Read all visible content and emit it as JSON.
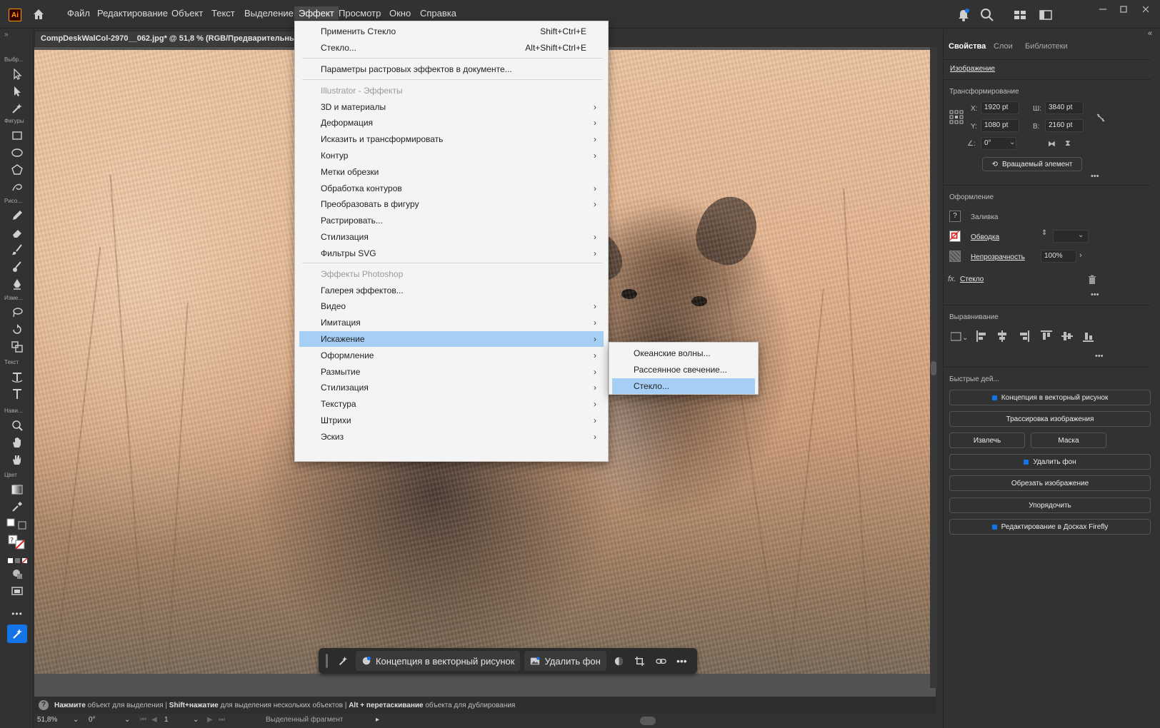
{
  "app": {
    "logo": "Ai",
    "menu": [
      "Файл",
      "Редактирование",
      "Объект",
      "Текст",
      "Выделение",
      "Эффект",
      "Просмотр",
      "Окно",
      "Справка"
    ],
    "active_menu": "Эффект"
  },
  "document": {
    "tab_title": "CompDeskWalCol-2970__062.jpg* @ 51,8 % (RGB/Предварительный"
  },
  "toolbar": {
    "section_labels": [
      "Выбр...",
      "Фигуры",
      "Рисо...",
      "Изме...",
      "Текст",
      "Нави...",
      "Цвет"
    ],
    "fill_unknown_glyph": "?"
  },
  "effect_menu": {
    "apply_last": {
      "label": "Применить Стекло",
      "shortcut": "Shift+Ctrl+E"
    },
    "last_effect": {
      "label": "Стекло...",
      "shortcut": "Alt+Shift+Ctrl+E"
    },
    "raster_settings": "Параметры растровых эффектов в документе...",
    "illustrator_header": "Illustrator - Эффекты",
    "illustrator_items": [
      {
        "label": "3D и материалы",
        "submenu": true
      },
      {
        "label": "Деформация",
        "submenu": true
      },
      {
        "label": "Исказить и трансформировать",
        "submenu": true
      },
      {
        "label": "Контур",
        "submenu": true
      },
      {
        "label": "Метки обрезки",
        "submenu": false
      },
      {
        "label": "Обработка контуров",
        "submenu": true
      },
      {
        "label": "Преобразовать в фигуру",
        "submenu": true
      },
      {
        "label": "Растрировать...",
        "submenu": false
      },
      {
        "label": "Стилизация",
        "submenu": true
      },
      {
        "label": "Фильтры SVG",
        "submenu": true
      }
    ],
    "photoshop_header": "Эффекты Photoshop",
    "photoshop_items": [
      {
        "label": "Галерея эффектов...",
        "submenu": false
      },
      {
        "label": "Видео",
        "submenu": true
      },
      {
        "label": "Имитация",
        "submenu": true
      },
      {
        "label": "Искажение",
        "submenu": true,
        "highlighted": true
      },
      {
        "label": "Оформление",
        "submenu": true
      },
      {
        "label": "Размытие",
        "submenu": true
      },
      {
        "label": "Стилизация",
        "submenu": true
      },
      {
        "label": "Текстура",
        "submenu": true
      },
      {
        "label": "Штрихи",
        "submenu": true
      },
      {
        "label": "Эскиз",
        "submenu": true
      }
    ],
    "arrow_glyph": "›"
  },
  "distort_submenu": {
    "items": [
      "Океанские волны...",
      "Рассеянное свечение...",
      "Стекло..."
    ],
    "highlighted": "Стекло..."
  },
  "right_panel": {
    "tabs": [
      "Свойства",
      "Слои",
      "Библиотеки"
    ],
    "active_tab": "Свойства",
    "object_type": "Изображение",
    "transform": {
      "title": "Трансформирование",
      "x_label": "X:",
      "x": "1920 pt",
      "y_label": "Y:",
      "y": "1080 pt",
      "w_label": "Ш:",
      "w": "3840 pt",
      "h_label": "В:",
      "h": "2160 pt",
      "angle": "0°",
      "rotate_button": "Вращаемый элемент"
    },
    "appearance": {
      "title": "Оформление",
      "fill_label": "Заливка",
      "stroke_label": "Обводка",
      "opacity_label": "Непрозрачность",
      "opacity_value": "100%",
      "effect_fx": "fx.",
      "effect_name": "Стекло"
    },
    "align": {
      "title": "Выравнивание"
    },
    "quick_actions": {
      "title": "Быстрые дей...",
      "buttons": {
        "vector_concept": "Концепция в векторный рисунок",
        "trace": "Трассировка изображения",
        "extract": "Извлечь",
        "mask": "Маска",
        "remove_bg": "Удалить фон",
        "crop": "Обрезать изображение",
        "arrange": "Упорядочить",
        "firefly": "Редактирование в Досках Firefly"
      }
    },
    "more": "•••"
  },
  "task_bar": {
    "vector_concept": "Концепция в векторный рисунок",
    "remove_bg": "Удалить фон",
    "more": "•••"
  },
  "status": {
    "hint_1_bold": "Нажмите",
    "hint_1": " объект для выделения  |  ",
    "hint_2_bold": "Shift+нажатие",
    "hint_2": " для выделения нескольких объектов  |  ",
    "hint_3_bold": "Alt + перетаскивание",
    "hint_3": " объекта для дублирования",
    "zoom": "51,8%",
    "rotation": "0°",
    "artboard": "1",
    "selection_info": "Выделенный фрагмент"
  },
  "colors": {
    "menu_bg": "#f4f4f4",
    "menu_highlight": "#a6cff5",
    "ui_dark": "#323232",
    "accent_blue": "#1473e6"
  }
}
